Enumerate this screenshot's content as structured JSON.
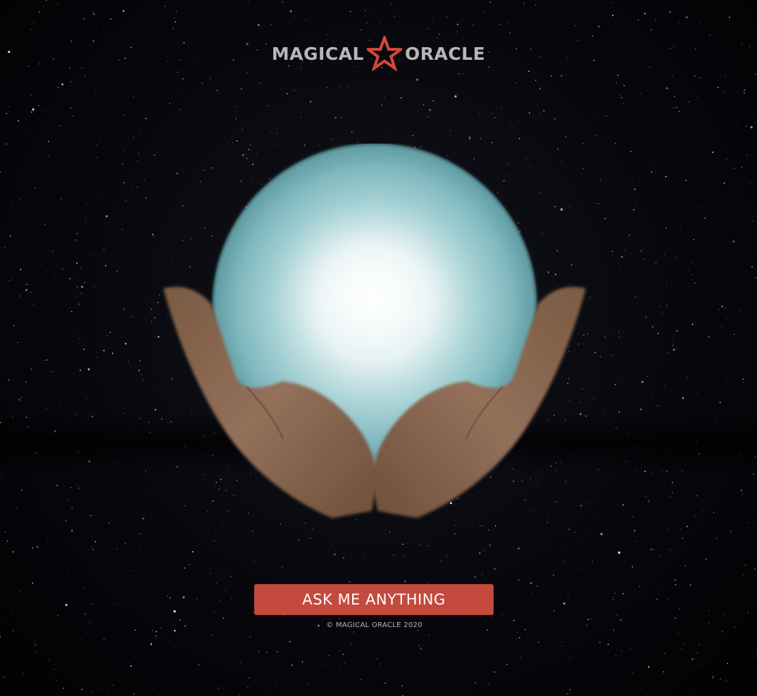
{
  "brand": {
    "name_left": "MAGICAL",
    "name_right": "ORACLE",
    "logo_icon": "star-outline-icon",
    "logo_color": "#d5473c",
    "text_color": "#b7b7b9"
  },
  "hero": {
    "image": "crystal-ball-in-hands",
    "orb_color": "#8fc3c9",
    "hand_color": "#8e6a4e"
  },
  "cta": {
    "label": "ASK ME ANYTHING",
    "color": "#c4493e"
  },
  "footer": {
    "copyright": "© MAGICAL ORACLE 2020"
  },
  "background": {
    "style": "starfield",
    "color": "#05060a"
  }
}
